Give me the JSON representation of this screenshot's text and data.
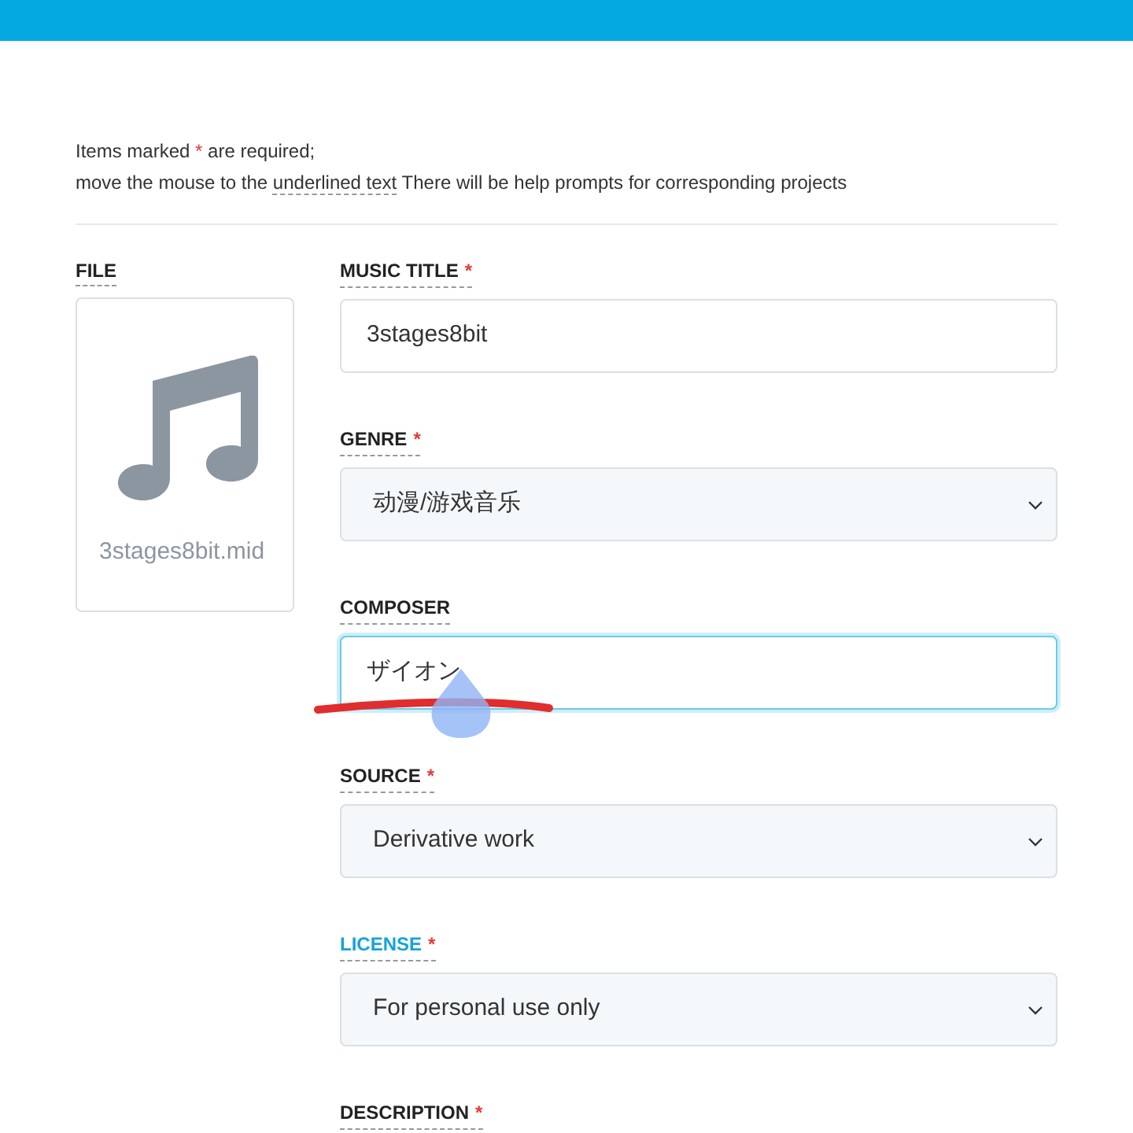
{
  "notice": {
    "before": "Items marked",
    "mark": "*",
    "after": "are required;",
    "line2_before": "move the mouse to the",
    "line2_link": "underlined text",
    "line2_after": "There will be help prompts for corresponding projects"
  },
  "file": {
    "label": "FILE",
    "filename": "3stages8bit.mid"
  },
  "fields": [
    {
      "label": "MUSIC TITLE",
      "kind": "input",
      "required": true,
      "highlighted": false,
      "focused": false,
      "value": "3stages8bit"
    },
    {
      "label": "GENRE",
      "kind": "select",
      "required": true,
      "highlighted": false,
      "focused": false,
      "value": "动漫/游戏音乐"
    },
    {
      "label": "COMPOSER",
      "kind": "input",
      "required": false,
      "highlighted": false,
      "focused": true,
      "value": "ザイオン"
    },
    {
      "label": "SOURCE",
      "kind": "select",
      "required": true,
      "highlighted": false,
      "focused": false,
      "value": "Derivative work"
    },
    {
      "label": "LICENSE",
      "kind": "select",
      "required": true,
      "highlighted": true,
      "focused": false,
      "value": "For personal use only"
    },
    {
      "label": "DESCRIPTION",
      "kind": "label",
      "required": true,
      "highlighted": false
    }
  ]
}
